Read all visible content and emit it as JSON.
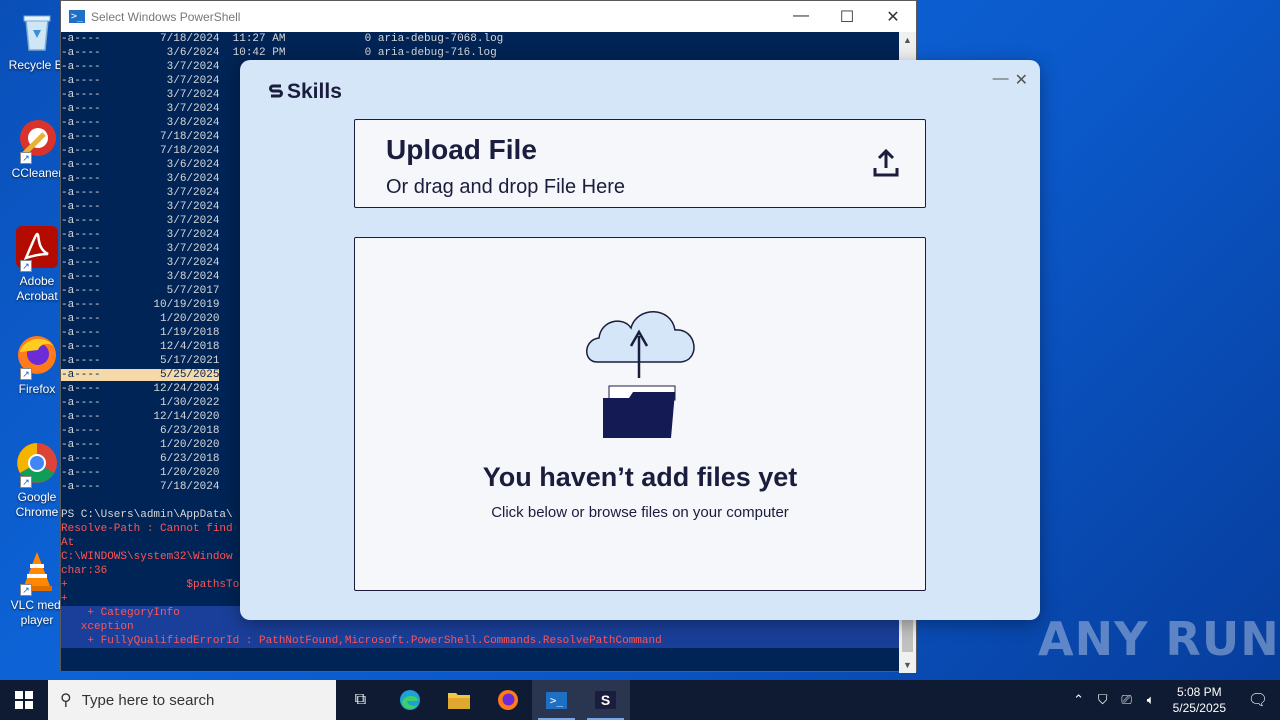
{
  "desktop": {
    "icons": [
      {
        "label": "Recycle Bin",
        "label_shown": "Recycle Bi"
      },
      {
        "label": "CCleaner",
        "label_shown": "CCleaner"
      },
      {
        "label": "Adobe Acrobat",
        "label_shown": "Adobe Acrobat"
      },
      {
        "label": "Firefox",
        "label_shown": "Firefox"
      },
      {
        "label": "Google Chrome",
        "label_shown": "Google Chrome"
      },
      {
        "label": "VLC media player",
        "label_shown": "VLC medi player"
      }
    ]
  },
  "powershell": {
    "title": "Select Windows PowerShell",
    "rows": [
      "-a----         7/18/2024  11:27 AM            0 aria-debug-7068.log",
      "-a----          3/6/2024  10:42 PM            0 aria-debug-716.log",
      "-a----          3/7/2024",
      "-a----          3/7/2024",
      "-a----          3/7/2024",
      "-a----          3/7/2024",
      "-a----          3/8/2024",
      "-a----         7/18/2024",
      "-a----         7/18/2024",
      "-a----          3/6/2024",
      "-a----          3/6/2024",
      "-a----          3/7/2024",
      "-a----          3/7/2024",
      "-a----          3/7/2024",
      "-a----          3/7/2024",
      "-a----          3/7/2024",
      "-a----          3/7/2024",
      "-a----          3/8/2024",
      "-a----          5/7/2017",
      "-a----        10/19/2019",
      "-a----         1/20/2020",
      "-a----         1/19/2018",
      "-a----         12/4/2018",
      "-a----         5/17/2021",
      "-a----         5/25/2025",
      "-a----        12/24/2024",
      "-a----         1/30/2022",
      "-a----        12/14/2020",
      "-a----         6/23/2018",
      "-a----         1/20/2020",
      "-a----         6/23/2018",
      "-a----         1/20/2020",
      "-a----         7/18/2024"
    ],
    "highlight_row": "-a----         5/25/2025",
    "prompt_line": "PS C:\\Users\\admin\\AppData\\",
    "error_lines": [
      "Resolve-Path : Cannot find",
      "At",
      "C:\\WINDOWS\\system32\\Window",
      "char:36",
      "+                  $pathsTo",
      "+"
    ],
    "error_full": [
      "    + CategoryInfo          : ObjectNotFound: (C:\\Users\\admin\\...p\\psfskills.exe:String) [Resolve-Path], ItemNotFoundE",
      "   xception",
      "    + FullyQualifiedErrorId : PathNotFound,Microsoft.PowerShell.Commands.ResolvePathCommand"
    ]
  },
  "skills": {
    "brand": "Skills",
    "upload_title": "Upload File",
    "upload_sub": "Or drag and drop File Here",
    "empty_title": "You haven’t add files yet",
    "empty_sub": "Click below or browse files on your computer"
  },
  "watermark": "ANY RUN",
  "taskbar": {
    "search_placeholder": "Type here to search",
    "time": "5:08 PM",
    "date": "5/25/2025"
  }
}
